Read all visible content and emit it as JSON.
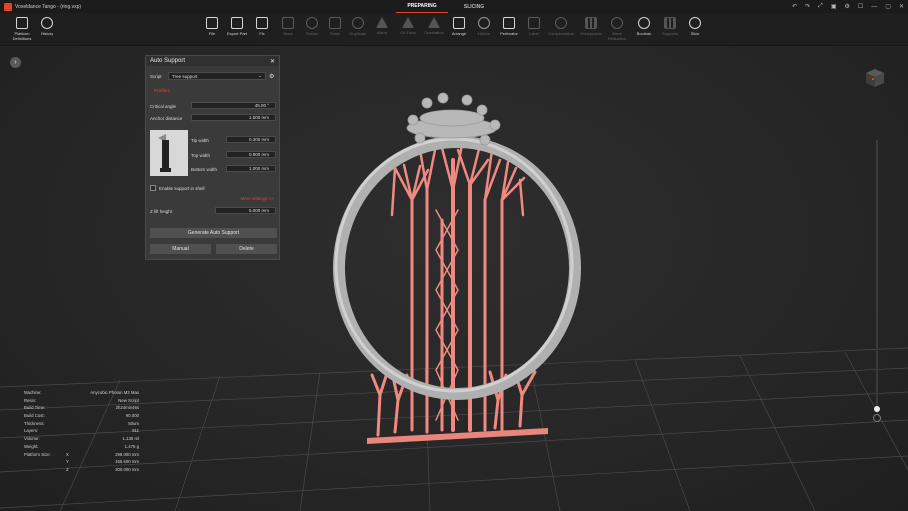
{
  "window": {
    "title": "Voxeldance Tango - (ring.vxp)",
    "controls": [
      "↶",
      "↷",
      "⤢",
      "▣",
      "⚙",
      "☐",
      "—",
      "▢",
      "✕"
    ]
  },
  "mode_tabs": [
    {
      "label": "PREPARING",
      "active": true
    },
    {
      "label": "SLICING",
      "active": false
    }
  ],
  "toolbar": {
    "left": [
      {
        "label": "Platform Definitions",
        "icon": "platform-icon"
      },
      {
        "label": "History",
        "icon": "history-icon"
      }
    ],
    "main": [
      {
        "label": "File",
        "icon": "folder-icon",
        "enabled": true
      },
      {
        "label": "Export Part",
        "icon": "export-icon",
        "enabled": true
      },
      {
        "label": "Fix",
        "icon": "fix-icon",
        "enabled": true
      },
      {
        "label": "Move",
        "icon": "move-icon",
        "enabled": false
      },
      {
        "label": "Rotate",
        "icon": "rotate-icon",
        "enabled": false
      },
      {
        "label": "Scale",
        "icon": "scale-icon",
        "enabled": false
      },
      {
        "label": "Duplicate",
        "icon": "duplicate-icon",
        "enabled": false
      },
      {
        "label": "Mirror",
        "icon": "mirror-icon",
        "enabled": false
      },
      {
        "label": "On Face",
        "icon": "on-face-icon",
        "enabled": false
      },
      {
        "label": "Orientation",
        "icon": "orientation-icon",
        "enabled": false
      },
      {
        "label": "Arrange",
        "icon": "arrange-icon",
        "enabled": true
      },
      {
        "label": "Hollow",
        "icon": "hollow-icon",
        "enabled": false
      },
      {
        "label": "Perforator",
        "icon": "perforator-icon",
        "enabled": true
      },
      {
        "label": "Label",
        "icon": "label-icon",
        "enabled": false
      },
      {
        "label": "Compensation",
        "icon": "compensation-icon",
        "enabled": false
      },
      {
        "label": "Honeycomb",
        "icon": "honeycomb-icon",
        "enabled": false
      },
      {
        "label": "Mesh Reduction",
        "icon": "mesh-reduction-icon",
        "enabled": false
      },
      {
        "label": "Boolean",
        "icon": "boolean-icon",
        "enabled": true
      },
      {
        "label": "Supports",
        "icon": "supports-icon",
        "enabled": false
      },
      {
        "label": "Slice",
        "icon": "slice-icon",
        "enabled": true
      }
    ]
  },
  "panel": {
    "title": "Auto Support",
    "script_label": "Script",
    "script_value": "Tree support",
    "profiles_label": "Profiles",
    "fields": [
      {
        "label": "Critical angle",
        "value": "45.00 °"
      },
      {
        "label": "Anchor distance",
        "value": "1.500 mm"
      }
    ],
    "tip_fields": [
      {
        "label": "Tip width",
        "value": "0.300 mm"
      },
      {
        "label": "Top width",
        "value": "0.900 mm"
      },
      {
        "label": "Bottom width",
        "value": "1.000 mm"
      }
    ],
    "checkbox_label": "Enable support in shell",
    "more_settings": "More settings >>",
    "zlift_label": "Z lift height",
    "zlift_value": "5.000 mm",
    "generate_label": "Generate Auto Support",
    "manual_label": "Manual",
    "delete_label": "Delete"
  },
  "info": [
    {
      "key": "Machine:",
      "value": "Anycubic Photon M3 Max"
    },
    {
      "key": "Resin:",
      "value": "New Script"
    },
    {
      "key": "Build Time:",
      "value": "2h24min46s"
    },
    {
      "key": "Build Cost:",
      "value": "¥0.000"
    },
    {
      "key": "Thickness:",
      "value": "50um"
    },
    {
      "key": "Layers:",
      "value": "911"
    },
    {
      "key": "Volume:",
      "value": "1.135 ml"
    },
    {
      "key": "Weight:",
      "value": "1.476 g"
    },
    {
      "key": "Platform Size:",
      "axis": "X",
      "value": "298.000 mm"
    },
    {
      "key": "",
      "axis": "Y",
      "value": "165.600 mm"
    },
    {
      "key": "",
      "axis": "Z",
      "value": "300.000 mm"
    }
  ],
  "colors": {
    "accent": "#e0452a",
    "support": "#f08a80",
    "model": "#a9a9a9",
    "panel": "#3a3a3a"
  }
}
